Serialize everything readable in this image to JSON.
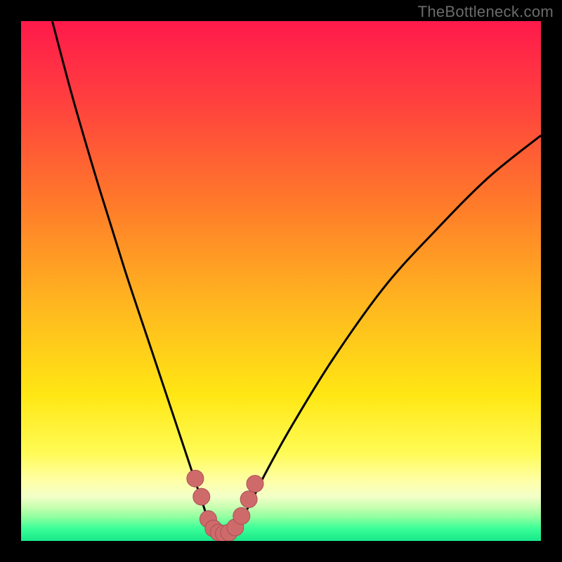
{
  "watermark": {
    "text": "TheBottleneck.com"
  },
  "colors": {
    "frame": "#000000",
    "curve": "#000000",
    "marker_fill": "#cf6a6b",
    "marker_stroke": "#a85253",
    "gradient_stops": [
      {
        "offset": 0.0,
        "color": "#ff1a4b"
      },
      {
        "offset": 0.15,
        "color": "#ff3f3f"
      },
      {
        "offset": 0.35,
        "color": "#ff7a2a"
      },
      {
        "offset": 0.55,
        "color": "#ffb81f"
      },
      {
        "offset": 0.72,
        "color": "#ffe714"
      },
      {
        "offset": 0.83,
        "color": "#fffb55"
      },
      {
        "offset": 0.885,
        "color": "#ffffa8"
      },
      {
        "offset": 0.915,
        "color": "#f2ffc8"
      },
      {
        "offset": 0.935,
        "color": "#c7ffb0"
      },
      {
        "offset": 0.955,
        "color": "#8dffa0"
      },
      {
        "offset": 0.975,
        "color": "#3dff99"
      },
      {
        "offset": 1.0,
        "color": "#17e889"
      }
    ]
  },
  "chart_data": {
    "type": "line",
    "title": "",
    "xlabel": "",
    "ylabel": "",
    "xlim": [
      0,
      100
    ],
    "ylim": [
      0,
      100
    ],
    "series": [
      {
        "name": "bottleneck-curve",
        "x": [
          6,
          10,
          15,
          20,
          25,
          30,
          33,
          35,
          36,
          37,
          38,
          39,
          40,
          41,
          42,
          44,
          47,
          52,
          60,
          70,
          80,
          90,
          100
        ],
        "y": [
          100,
          85,
          68,
          52,
          37,
          22,
          13,
          7,
          4,
          2.2,
          1.6,
          1.4,
          1.6,
          2.3,
          3.8,
          7,
          13,
          22,
          35,
          49,
          60,
          70,
          78
        ]
      }
    ],
    "markers": {
      "name": "highlight-region",
      "x": [
        33.5,
        34.7,
        36.0,
        37.0,
        38.0,
        39.0,
        40.0,
        41.2,
        42.4,
        43.8,
        45.0
      ],
      "y": [
        12.0,
        8.5,
        4.2,
        2.4,
        1.6,
        1.4,
        1.6,
        2.6,
        4.8,
        8.0,
        11.0
      ],
      "r": 12
    }
  }
}
